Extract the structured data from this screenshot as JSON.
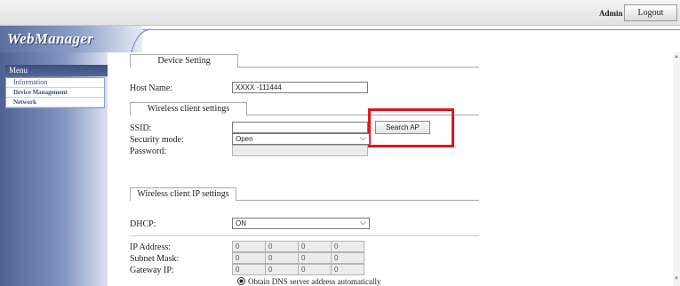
{
  "header": {
    "user": "Admin",
    "logout_label": "Logout"
  },
  "brand": {
    "logo_text": "WebManager"
  },
  "sidebar": {
    "menu_label": "Menu",
    "items": [
      {
        "label": "Information"
      },
      {
        "label": "Device Management"
      },
      {
        "label": "Network"
      }
    ]
  },
  "device_setting": {
    "tab_label": "Device Setting",
    "host_name_label": "Host Name:",
    "host_name_value": "XXXX -111444"
  },
  "wireless_client": {
    "tab_label": "Wireless client settings",
    "ssid_label": "SSID:",
    "ssid_value": "",
    "search_ap_label": "Search AP",
    "security_mode_label": "Security mode:",
    "security_mode_value": "Open",
    "password_label": "Password:",
    "password_value": ""
  },
  "wireless_ip": {
    "tab_label": "Wireless client IP settings",
    "dhcp_label": "DHCP:",
    "dhcp_value": "ON",
    "ip_address_label": "IP Address:",
    "subnet_mask_label": "Subnet Mask:",
    "gateway_label": "Gateway IP:",
    "ip_address": [
      "0",
      "0",
      "0",
      "0"
    ],
    "subnet_mask": [
      "0",
      "0",
      "0",
      "0"
    ],
    "gateway": [
      "0",
      "0",
      "0",
      "0"
    ],
    "dns_option_label": "Obtain DNS server address automatically"
  },
  "colors": {
    "highlight": "#e0141e",
    "sidebar": "#5a6f9e"
  }
}
